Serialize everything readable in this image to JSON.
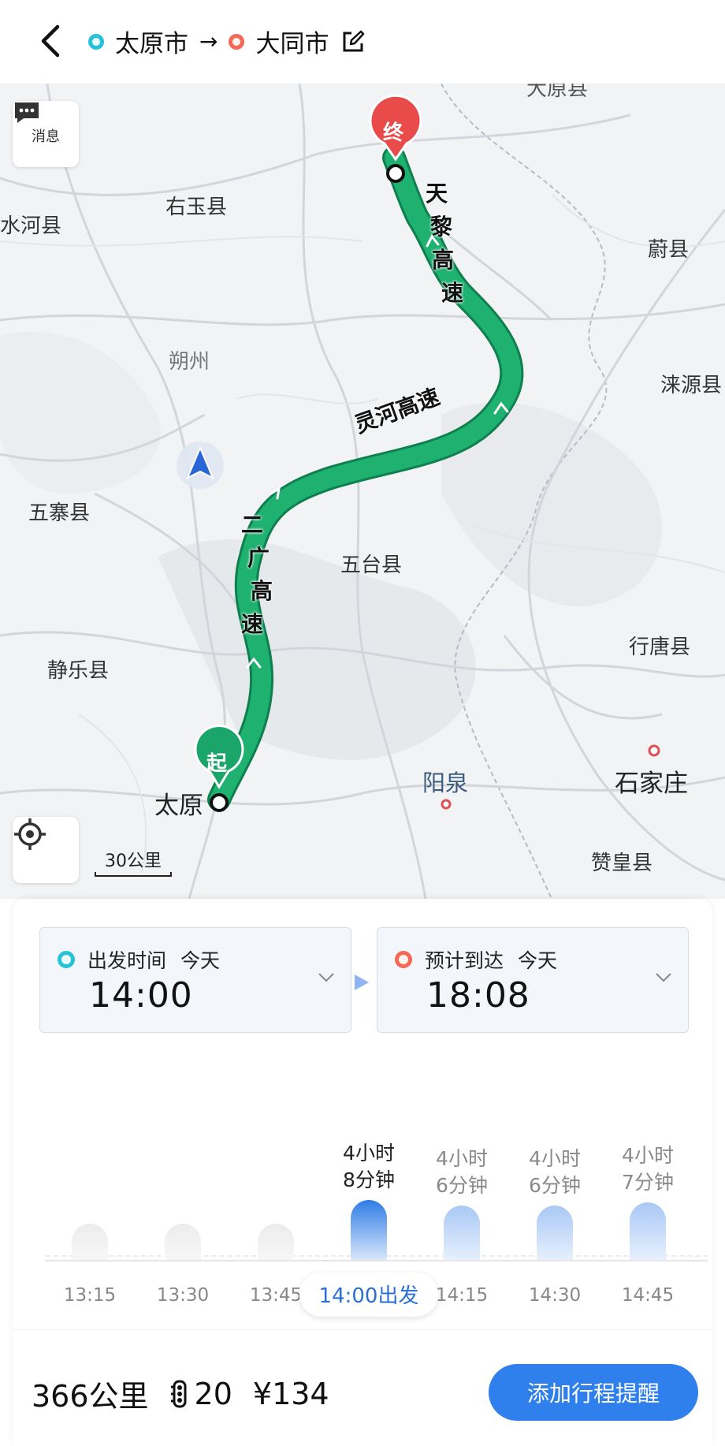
{
  "header": {
    "origin": "太原市",
    "arrow": "→",
    "destination": "大同市"
  },
  "map": {
    "message_label": "消息",
    "scale_label": "30公里",
    "start_marker": "起",
    "end_marker": "终",
    "places": {
      "youyu": "右玉县",
      "shuihe": "水河县",
      "weixian": "蔚县",
      "shuozhou": "朔州",
      "laiyuan": "涞源县",
      "wuzhai": "五寨县",
      "wutai": "五台县",
      "jingle": "静乐县",
      "xingtang": "行唐县",
      "yangquan": "阳泉",
      "shijiazhuang": "石家庄",
      "taiyuan": "太原",
      "zanhuang": "赞皇县",
      "top_cut": "大原县"
    },
    "roads": {
      "tianli": [
        "天",
        "黎",
        "高",
        "速"
      ],
      "linghe": "灵河高速",
      "erguang": [
        "二",
        "广",
        "高",
        "速"
      ]
    },
    "colors": {
      "route": "#1aa56a",
      "route_border": "#0f7f4f",
      "end_pin": "#e94b4b",
      "start_pin": "#1aa56a"
    }
  },
  "depart": {
    "label": "出发时间",
    "day": "今天",
    "time": "14:00"
  },
  "arrive": {
    "label": "预计到达",
    "day": "今天",
    "time": "18:08"
  },
  "chart_data": {
    "type": "bar",
    "categories": [
      "13:15",
      "13:30",
      "13:45",
      "14:00出发",
      "14:15",
      "14:30",
      "14:45"
    ],
    "values": [
      null,
      null,
      null,
      248,
      246,
      246,
      247
    ],
    "durations": [
      [
        "",
        ""
      ],
      [
        "",
        ""
      ],
      [
        "",
        ""
      ],
      [
        "4小时",
        "8分钟"
      ],
      [
        "4小时",
        "6分钟"
      ],
      [
        "4小时",
        "6分钟"
      ],
      [
        "4小时",
        "7分钟"
      ]
    ],
    "selected_index": 3,
    "unit": "minutes"
  },
  "summary": {
    "distance": "366公里",
    "traffic_lights": "20",
    "cost": "¥134",
    "add_button": "添加行程提醒"
  }
}
